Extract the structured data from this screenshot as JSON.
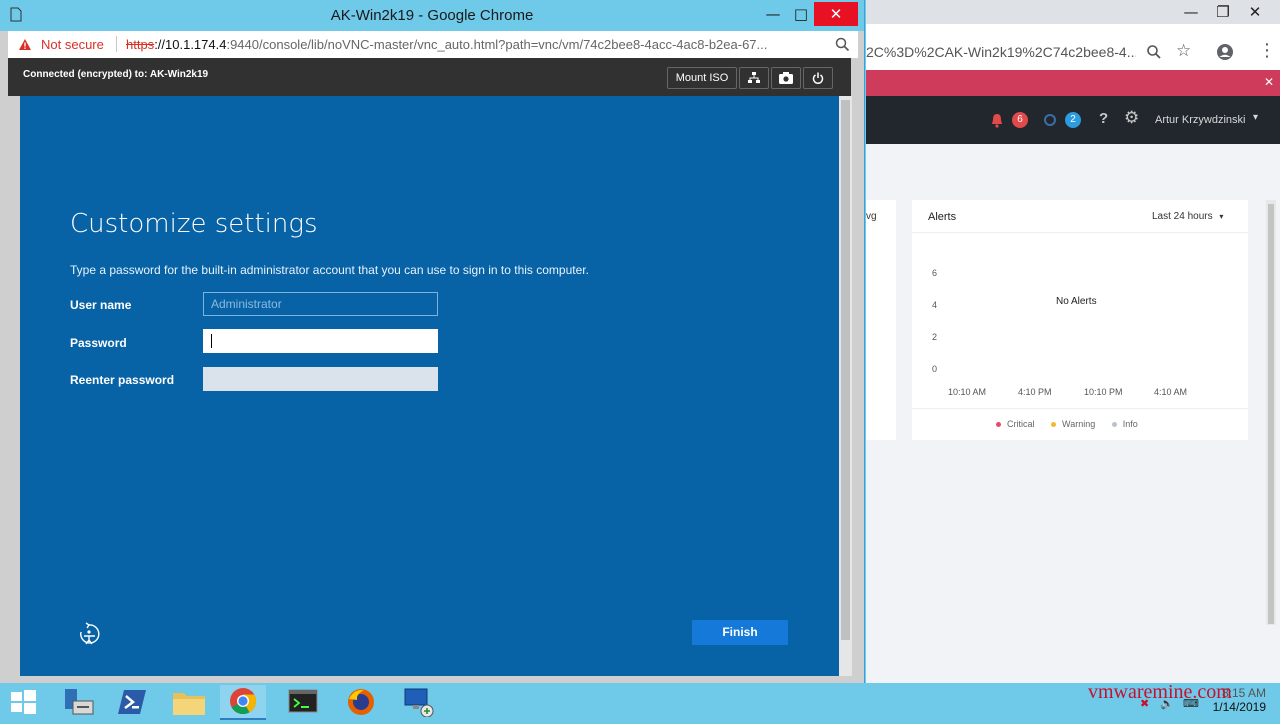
{
  "fg_window": {
    "title": "AK-Win2k19 - Google Chrome",
    "security_label": "Not secure",
    "url_scheme": "https",
    "url_host": "://10.1.174.4",
    "url_rest": ":9440/console/lib/noVNC-master/vnc_auto.html?path=vnc/vm/74c2bee8-4acc-4ac8-b2ea-67..."
  },
  "vnc": {
    "status": "Connected (encrypted) to: AK-Win2k19",
    "mount_iso_label": "Mount ISO"
  },
  "setup": {
    "title": "Customize settings",
    "description": "Type a password for the built-in administrator account that you can use to sign in to this computer.",
    "username_label": "User name",
    "username_value": "Administrator",
    "password_label": "Password",
    "reenter_label": "Reenter password",
    "finish_label": "Finish"
  },
  "bg_window": {
    "url": "2C%3D%2CAK-Win2k19%2C74c2bee8-4...",
    "alerts_badge": "6",
    "tasks_badge": "2",
    "user_name": "Artur Krzywdzinski",
    "left_cut_label": "vg",
    "card": {
      "title": "Alerts",
      "range_label": "Last 24 hours",
      "empty_label": "No Alerts",
      "y_ticks": [
        "6",
        "4",
        "2",
        "0"
      ],
      "x_ticks": [
        "10:10 AM",
        "4:10 PM",
        "10:10 PM",
        "4:10 AM"
      ],
      "legend": [
        {
          "label": "Critical",
          "color": "#e8486b"
        },
        {
          "label": "Warning",
          "color": "#f5b731"
        },
        {
          "label": "Info",
          "color": "#b9c1cc"
        }
      ]
    }
  },
  "taskbar": {
    "time": "8:15 AM",
    "date": "1/14/2019",
    "watermark": "vmwaremine.com"
  },
  "colors": {
    "vm_blue": "#0863a6",
    "title_bar": "#6fc9e8",
    "alert_red": "#e04a4a",
    "task_blue": "#2d9be0"
  }
}
